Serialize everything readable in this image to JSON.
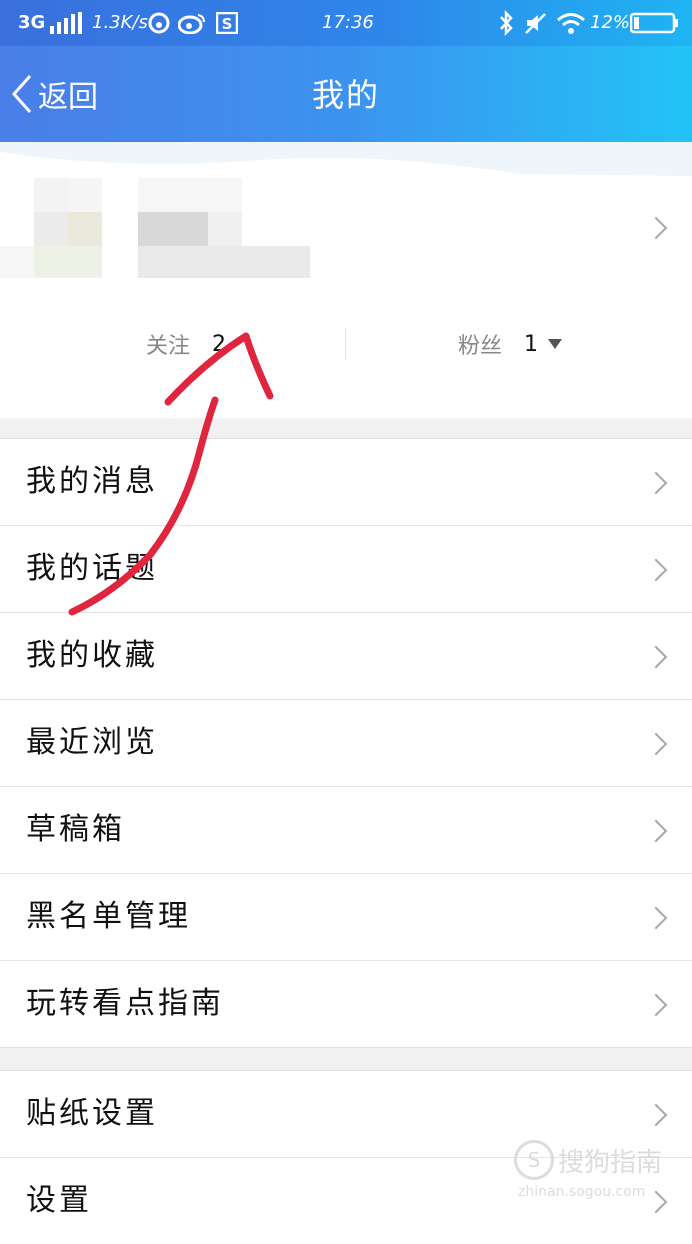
{
  "status_bar": {
    "network": "3G",
    "speed": "1.3K/s",
    "time": "17:36",
    "battery": "12%",
    "icons": [
      "signal-icon",
      "netease-icon",
      "weibo-icon",
      "s-app-icon",
      "bluetooth-icon",
      "mute-icon",
      "wifi-icon",
      "battery-icon"
    ]
  },
  "nav": {
    "back_label": "返回",
    "title": "我的"
  },
  "profile": {
    "following_label": "关注",
    "following_count": "2",
    "followers_label": "粉丝",
    "followers_count": "1"
  },
  "menu_group1": [
    {
      "label": "我的消息"
    },
    {
      "label": "我的话题"
    },
    {
      "label": "我的收藏"
    },
    {
      "label": "最近浏览"
    },
    {
      "label": "草稿箱"
    },
    {
      "label": "黑名单管理"
    },
    {
      "label": "玩转看点指南"
    }
  ],
  "menu_group2": [
    {
      "label": "贴纸设置"
    },
    {
      "label": "设置"
    }
  ],
  "watermark": {
    "text": "搜狗指南",
    "url": "zhinan.sogou.com"
  },
  "colors": {
    "header_start": "#4a7ee8",
    "header_end": "#22c3f6",
    "annotation": "#e0253f"
  }
}
